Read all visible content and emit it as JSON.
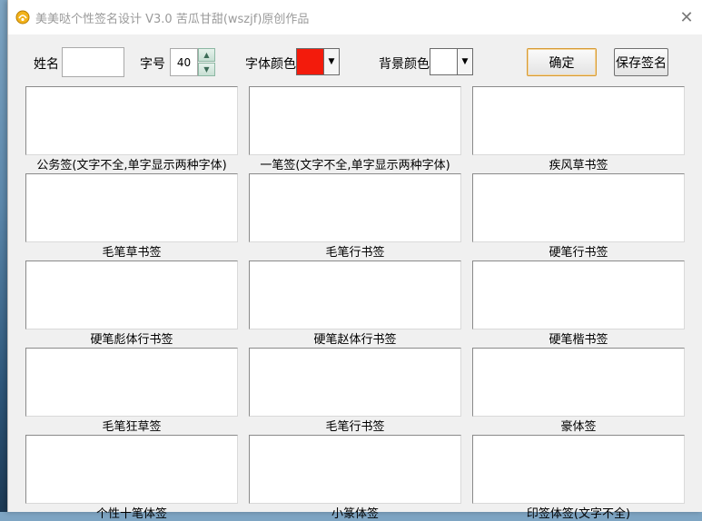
{
  "window": {
    "title": "美美哒个性签名设计 V3.0    苦瓜甘甜(wszjf)原创作品",
    "close_symbol": "✕"
  },
  "toolbar": {
    "name_label": "姓名",
    "name_value": "",
    "size_label": "字号",
    "size_value": "40",
    "font_color_label": "字体颜色",
    "font_color": "#f31b0c",
    "bg_color_label": "背景颜色",
    "bg_color": "#ffffff",
    "confirm_label": "确定",
    "save_label": "保存签名"
  },
  "styles": [
    "公务签(文字不全,单字显示两种字体)",
    "一笔签(文字不全,单字显示两种字体)",
    "疾风草书签",
    "毛笔草书签",
    "毛笔行书签",
    "硬笔行书签",
    "硬笔彪体行书签",
    "硬笔赵体行书签",
    "硬笔楷书签",
    "毛笔狂草签",
    "毛笔行书签",
    "豪体签",
    "个性十笔体签",
    "小篆体签",
    "印签体签(文字不全)"
  ]
}
